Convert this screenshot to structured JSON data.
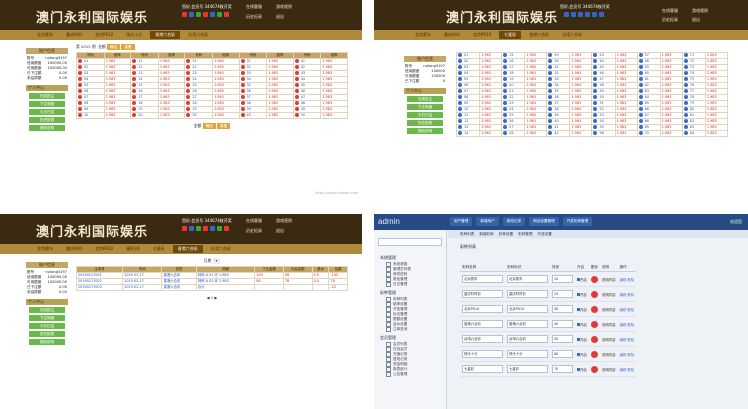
{
  "site": {
    "title": "澳门永利国际娱乐",
    "user_line": "您好,会员号 344674枚开奖",
    "toplinks": [
      "在线客服",
      "游戏规则",
      "历史纪录",
      "退出"
    ]
  },
  "panel1": {
    "nav": [
      "北京赛车",
      "重庆时时",
      "北京PK10",
      "快乐十分",
      "七星彩",
      "香港六合彩",
      "台湾六合彩"
    ],
    "active_index": 5,
    "account_head": "账户信息",
    "account_rows": [
      [
        "账号",
        "ruilong3197"
      ],
      [
        "信用额度",
        "100000.00"
      ],
      [
        "可用额度",
        "100000.00"
      ],
      [
        "已下注额",
        "0.00"
      ],
      [
        "未结算额",
        "0.00"
      ]
    ],
    "side_group": "个人中心",
    "side_buttons": [
      "在线投注",
      "下注明细",
      "今日已结",
      "历史报表",
      "规则说明"
    ],
    "period": "第 2015 期",
    "amount_label": "金额",
    "confirm": "确定",
    "reset": "重置",
    "quick_label": "快选",
    "footer_label": "金额",
    "watermark": "https://www.huzhan.com",
    "grid_headers": [
      "号码",
      "赔率",
      "号码",
      "赔率",
      "号码",
      "赔率",
      "号码",
      "赔率",
      "号码",
      "赔率"
    ],
    "odds": "1.983"
  },
  "panel2": {
    "nav": [
      "北京赛车",
      "重庆时时",
      "北京PK10",
      "七星彩",
      "香港六合彩",
      "台湾六合彩",
      "台湾六合彩"
    ],
    "active_index": 3,
    "account_head": "账户信息",
    "account_rows": [
      [
        "账号",
        "ruilong3197"
      ],
      [
        "信用额度",
        "100000"
      ],
      [
        "可用额度",
        "100000"
      ],
      [
        "已下注额",
        "0"
      ],
      [
        "未结算额",
        "0"
      ]
    ],
    "side_group": "个人中心",
    "side_buttons": [
      "在线投注",
      "下注明细",
      "今日已结",
      "历史报表",
      "规则说明"
    ],
    "odds": "1.983"
  },
  "panel3": {
    "nav": [
      "北京赛车",
      "重庆时时",
      "北京PK10",
      "福利3D",
      "七星彩",
      "香港六合彩",
      "台湾六合彩"
    ],
    "active_index": 5,
    "account_head": "账户信息",
    "account_rows": [
      [
        "账号",
        "ruilong3197"
      ],
      [
        "信用额度",
        "100000.00"
      ],
      [
        "可用额度",
        "100000.00"
      ],
      [
        "已下注额",
        "0.00"
      ],
      [
        "未结算额",
        "0.00"
      ]
    ],
    "side_group": "个人中心",
    "side_buttons": [
      "在线投注",
      "下注明细",
      "今日已结",
      "历史报表",
      "规则说明"
    ],
    "date_label": "日期",
    "table_headers": [
      "注单号",
      "时间",
      "类型",
      "明细",
      "下注金额",
      "可赢金额",
      "退水",
      "结果"
    ],
    "rows": [
      [
        "20190217001",
        "2019-02-17",
        "香港六合彩",
        "特码 A 01 @ 1.983",
        "100",
        "98",
        "0.5",
        "-100"
      ],
      [
        "20190217002",
        "2019-02-17",
        "香港六合彩",
        "特码 A 02 @ 1.983",
        "80",
        "78",
        "0.4",
        "78"
      ],
      [
        "20190217003",
        "2019-02-17",
        "香港六合彩",
        "合计",
        "",
        "",
        "",
        "-22"
      ]
    ]
  },
  "panel4": {
    "logo": "admin",
    "tabs": [
      "用户管理",
      "新增用户",
      "修改记录",
      "网站设置管理",
      "开奖彩种管理"
    ],
    "top_right": "欢迎您",
    "left_groups": [
      {
        "title": "系统管理",
        "items": [
          "系统参数",
          "管理员列表",
          "修改密码",
          "角色管理",
          "日志管理"
        ]
      },
      {
        "title": "彩种管理",
        "items": [
          "彩种列表",
          "赔率设置",
          "开奖管理",
          "玩法管理",
          "限额设置",
          "返水设置",
          "注单查询"
        ]
      },
      {
        "title": "会员管理",
        "items": [
          "会员列表",
          "在线会员",
          "充值记录",
          "提现记录",
          "资金明细",
          "报表统计",
          "公告管理"
        ]
      }
    ],
    "subbar": [
      "彩种列表",
      "新增彩种",
      "彩种设置",
      "彩种管理",
      "开奖设置"
    ],
    "section_title": "彩种列表",
    "headers": [
      "彩种名称",
      "彩种标识",
      "排序",
      "开启",
      "图标",
      "说明",
      "操作"
    ],
    "rows": [
      [
        "北京赛车",
        "北京赛车",
        "10",
        "开启",
        "说明内容"
      ],
      [
        "重庆时时彩",
        "重庆时时彩",
        "20",
        "开启",
        "说明内容"
      ],
      [
        "北京PK10",
        "北京PK10",
        "30",
        "开启",
        "说明内容"
      ],
      [
        "香港六合彩",
        "香港六合彩",
        "40",
        "开启",
        "说明内容"
      ],
      [
        "台湾六合彩",
        "台湾六合彩",
        "50",
        "开启",
        "说明内容"
      ],
      [
        "快乐十分",
        "快乐十分",
        "60",
        "开启",
        "说明内容"
      ],
      [
        "七星彩",
        "七星彩",
        "70",
        "开启",
        "说明内容"
      ]
    ],
    "action_edit": "编辑",
    "action_delete": "删除"
  }
}
